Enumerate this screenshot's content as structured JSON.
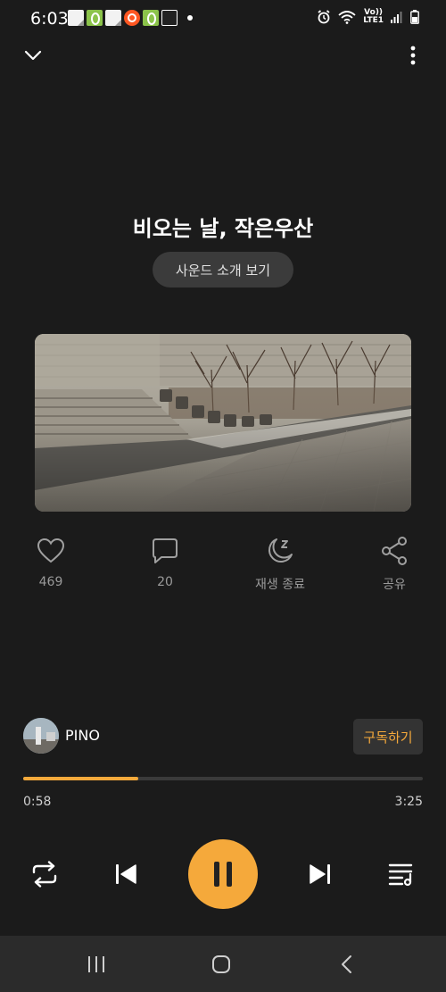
{
  "status_bar": {
    "time": "6:03",
    "network_top": "Vo))",
    "network_bottom": "LTE1"
  },
  "player": {
    "title": "비오는 날, 작은우산",
    "intro_button": "사운드 소개 보기"
  },
  "actions": {
    "like_count": "469",
    "comment_count": "20",
    "sleep_label": "재생 종료",
    "share_label": "공유"
  },
  "channel": {
    "name": "PINO",
    "subscribe_label": "구독하기"
  },
  "playback": {
    "current_time": "0:58",
    "total_time": "3:25",
    "progress_fraction": 0.287
  },
  "colors": {
    "accent": "#f5a93b",
    "background": "#1b1b1b"
  },
  "icons": {
    "collapse": "chevron-down-icon",
    "more": "more-vertical-icon",
    "like": "heart-icon",
    "comment": "comment-icon",
    "sleep": "moon-zz-icon",
    "share": "share-icon",
    "repeat": "repeat-icon",
    "prev": "skip-previous-icon",
    "pause": "pause-icon",
    "next": "skip-next-icon",
    "queue": "playlist-icon"
  }
}
